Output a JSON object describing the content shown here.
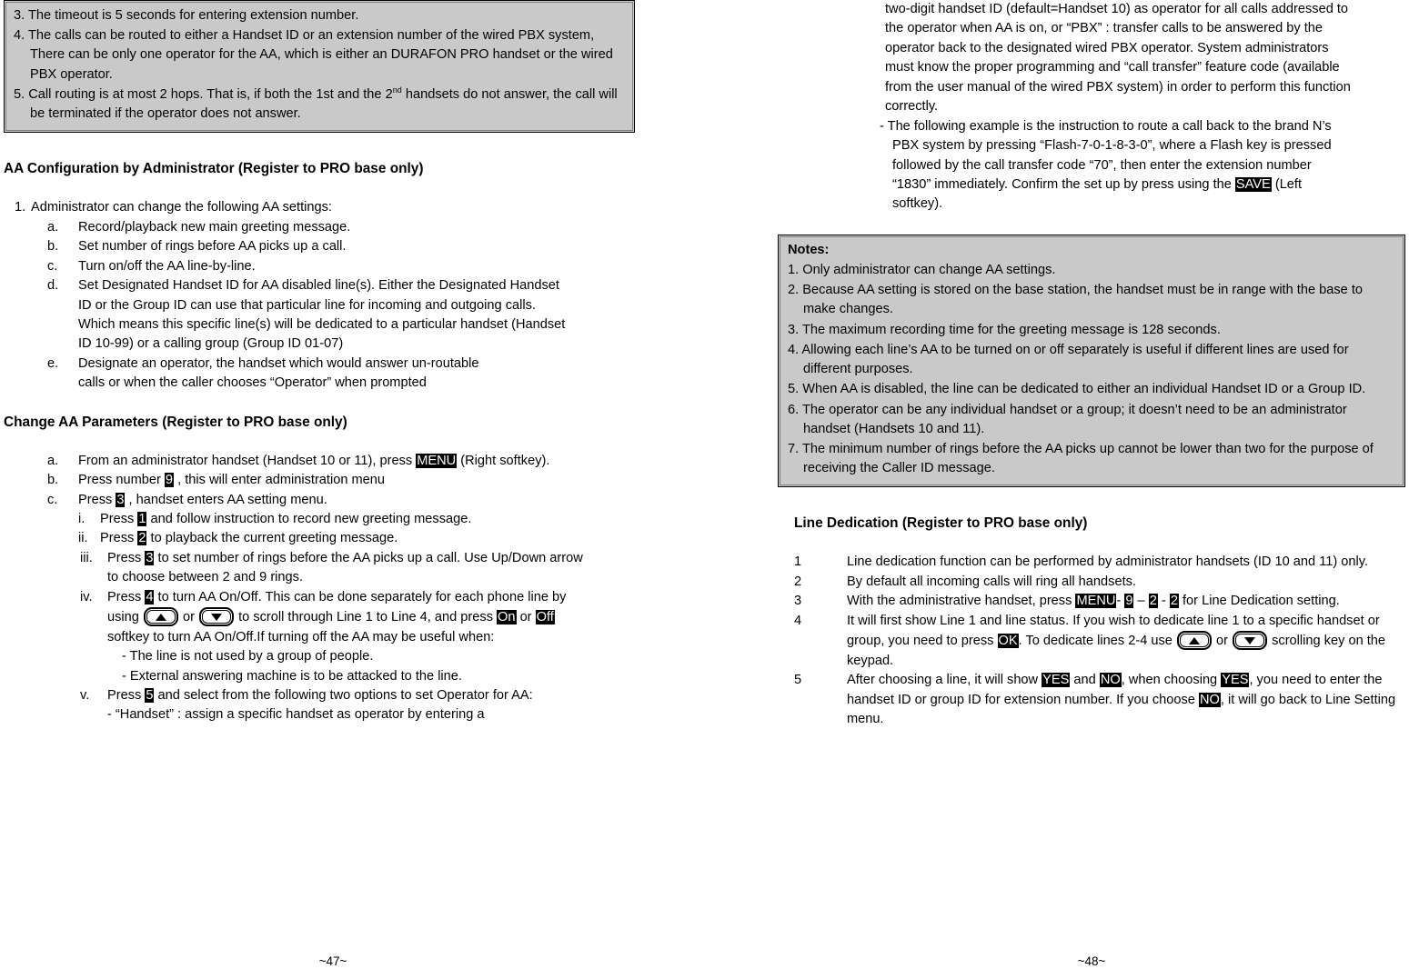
{
  "left_page": {
    "page_number": "~47~",
    "top_callout": {
      "items": [
        {
          "num": "3.",
          "text": "The timeout is 5 seconds for entering extension number."
        },
        {
          "num": "4.",
          "text": "The calls can be routed to either a Handset ID or an extension number of the wired PBX system, There can be only one operator for the AA, which is either an DURAFON PRO handset or the wired PBX operator."
        },
        {
          "num": "5.",
          "text_part1": "Call routing is at most 2 hops. That is, if both the 1st and the 2",
          "sup": "nd",
          "text_part2": " handsets do not answer, the call will be terminated if the operator does not answer."
        }
      ]
    },
    "heading_aa_config": "AA Configuration by Administrator (Register to PRO base only)",
    "item1_marker": "1.",
    "item1_text": "Administrator can change the following AA settings:",
    "sub_items": [
      {
        "marker": "a.",
        "text": "Record/playback new main greeting message."
      },
      {
        "marker": "b.",
        "text": "Set number of rings before AA picks up a call."
      },
      {
        "marker": "c.",
        "text": "Turn on/off the AA line-by-line."
      },
      {
        "marker": "d.",
        "text": "Set Designated Handset ID for AA disabled line(s). Either the Designated Handset ID or the Group ID can use that particular line for incoming and outgoing calls. Which means this specific line(s) will be dedicated to a particular handset (Handset ID 10-99) or a calling group (Group ID 01-07)"
      },
      {
        "marker": "e.",
        "text": "Designate an operator, the handset which would answer un-routable calls or when the caller chooses “Operator” when prompted"
      }
    ],
    "heading_change_params": "Change AA Parameters (Register to PRO base only)",
    "step_a": {
      "marker": "a.",
      "text_before": "From an administrator handset (Handset 10 or 11), press ",
      "key": "MENU",
      "text_after": " (Right softkey)."
    },
    "step_b": {
      "marker": "b.",
      "text_before": "Press number  ",
      "key": "9",
      "text_after": " , this will enter administration menu"
    },
    "step_c": {
      "marker": "c.",
      "text_before": "Press ",
      "key": "3",
      "text_after": " , handset enters AA setting menu."
    },
    "roman_steps": [
      {
        "marker": "i.",
        "text_before": "Press ",
        "key": "1",
        "text_after": "  and follow instruction to record new greeting message."
      },
      {
        "marker": "ii.",
        "text_before": "Press ",
        "key": "2",
        "text_after": " to playback the current greeting message."
      },
      {
        "marker": "iii.",
        "text_before": "Press ",
        "key": "3",
        "text_after": " to set number of rings before the AA picks up a call. Use Up/Down arrow to choose between 2 and 9 rings."
      }
    ],
    "step_iv": {
      "marker": "iv.",
      "text_before": "Press ",
      "key": "4",
      "text_mid1": "  to turn AA On/Off. This can be done separately for each phone line by using ",
      "or_word": " or ",
      "text_mid2": " to scroll through Line 1 to Line 4, and press ",
      "key_on": "On",
      "or_word2": " or ",
      "key_off": "Off",
      "text_after": " softkey to turn AA On/Off.If turning off the AA may be useful when:",
      "bullets": [
        "- The line is not used by a group of people.",
        "- External answering machine is to be attacked to the line."
      ]
    },
    "step_v": {
      "marker": "v.",
      "text_before": "Press ",
      "key": "5",
      "text_after": " and select from the following two options to set Operator for AA:",
      "bullet": "- “Handset” : assign a specific handset as operator by entering a"
    }
  },
  "right_page": {
    "page_number": "~48~",
    "continuation_paragraph": "two-digit handset ID (default=Handset 10) as operator for all calls addressed to the operator when AA is on, or “PBX” : transfer calls to be answered by the operator back to the designated wired PBX operator. System administrators must know the proper programming and “call transfer” feature code (available from the user manual of the wired PBX system) in order to perform this function correctly.",
    "example_paragraph": {
      "text_before": "- The following example is the instruction to route a call back to the brand N’s PBX system by pressing “Flash-7-0-1-8-3-0”, where a Flash key is pressed followed by the call transfer code “70”, then enter the extension number “1830” immediately. Confirm the set up by press using the ",
      "key": "SAVE",
      "text_after": " (Left softkey)."
    },
    "notes_callout": {
      "title": "Notes:",
      "items": [
        {
          "num": "1.",
          "text": "Only administrator can change AA settings."
        },
        {
          "num": "2.",
          "text": "Because AA setting is stored on the base station, the handset must be in range with the base to make changes."
        },
        {
          "num": "3.",
          "text": "The maximum recording time for the greeting message is 128 seconds."
        },
        {
          "num": "4.",
          "text": "Allowing each line’s AA to be turned on or off separately is useful if different lines are used for different purposes."
        },
        {
          "num": "5.",
          "text": "When AA is disabled, the line can be dedicated to either an individual Handset ID or a Group ID."
        },
        {
          "num": "6.",
          "text": "The operator can be any individual handset or a group; it doesn’t need to be an administrator handset (Handsets 10 and 11)."
        },
        {
          "num": "7.",
          "text": "The minimum number of rings before the AA picks up cannot be lower than two for the purpose of receiving the Caller ID message."
        }
      ]
    },
    "heading_line_dedication": "Line Dedication (Register to PRO base only)",
    "ld_item1": {
      "marker": "1",
      "text": "Line dedication function can be performed by administrator handsets (ID 10 and 11) only."
    },
    "ld_item2": {
      "marker": "2",
      "text": "By default all incoming calls will ring all handsets."
    },
    "ld_item3": {
      "marker": "3",
      "text_before": "With the administrative handset, press ",
      "key_menu": "MENU",
      "sep1": "- ",
      "key_9": "9",
      "sep2": " – ",
      "key_2a": "2",
      "sep3": " - ",
      "key_2b": "2",
      "text_after": " for Line Dedication setting."
    },
    "ld_item4": {
      "marker": "4",
      "text_before": "It will first show Line 1 and line status. If you wish to dedicate line 1 to a specific handset or group, you need to press ",
      "key_ok": "OK",
      "text_mid": ". To dedicate lines 2-4 use ",
      "or_word": " or ",
      "text_after": " scrolling key on the keypad."
    },
    "ld_item5": {
      "marker": "5",
      "text_before": "After choosing a line, it will show ",
      "key_yes1": "YES",
      "sep_and": " and ",
      "key_no1": "NO",
      "text_mid1": ", when choosing ",
      "key_yes2": "YES",
      "text_mid2": ", you need to enter the handset ID or group ID for extension number. If you choose ",
      "key_no2": "NO",
      "text_after": ", it will go back to Line Setting menu."
    }
  },
  "colors": {
    "callout_fill": "#c9c9c9",
    "key_bg": "#000000",
    "key_fg": "#ffffff",
    "text": "#000000"
  }
}
